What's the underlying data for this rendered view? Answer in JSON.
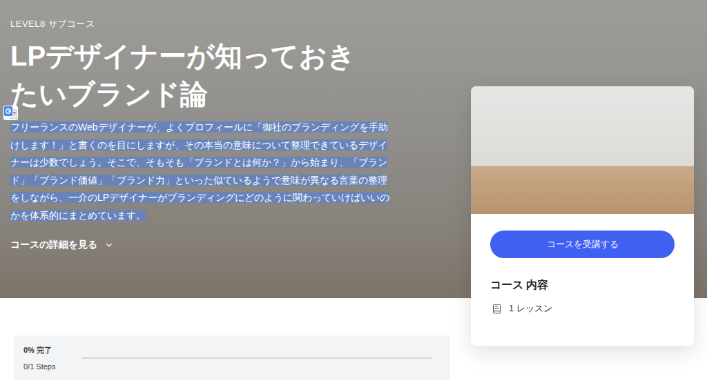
{
  "hero": {
    "label": "LEVEL8 サブコース",
    "title": "LPデザイナーが知っておきたいブランド論",
    "description": {
      "text": "フリーランスのWebデザイナーが、よくプロフィールに「御社のブランディングを手助けします！」と書くのを目にしますが、その本当の意味について整理できているデザイナーは少数でしょう。そこで、そもそも「ブランドとは何か？」から始まり、「ブランド」「ブランド価値」「ブランド力」といった似ているようで意味が異なる言葉の整理をしながら、一介のLPデザイナーがブランディングにどのように関わっていけばいいのかを体系的にまとめています。",
      "selected": true
    },
    "details_link": "コースの詳細を見る"
  },
  "card": {
    "button": "コースを受講する",
    "contents_title": "コース 内容",
    "items": [
      {
        "label": "1 レッスン"
      }
    ]
  },
  "progress": {
    "percent_label": "0% 完了",
    "steps": "0/1 Steps",
    "level": 0
  }
}
